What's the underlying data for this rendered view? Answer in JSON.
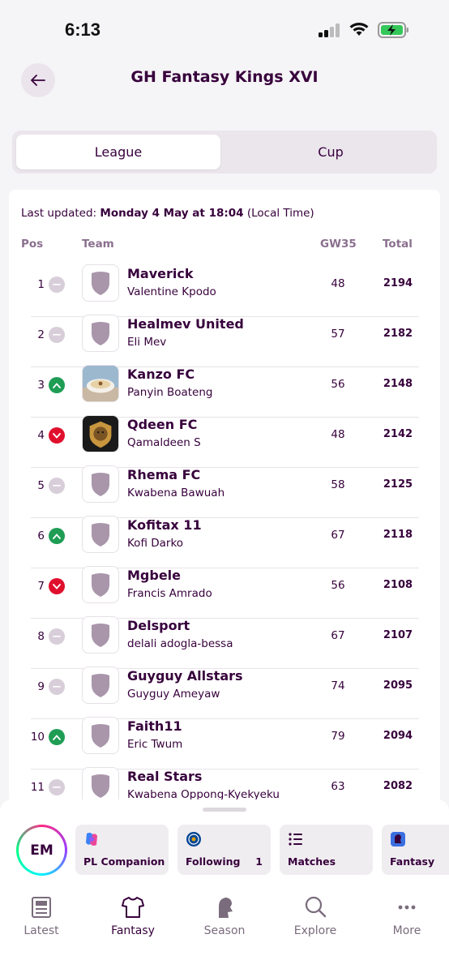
{
  "status": {
    "time": "6:13"
  },
  "header": {
    "title": "GH Fantasy Kings XVI"
  },
  "tabs": [
    {
      "label": "League",
      "active": true
    },
    {
      "label": "Cup",
      "active": false
    }
  ],
  "updated": {
    "prefix": "Last updated:",
    "value": "Monday 4 May at 18:04",
    "suffix": "(Local Time)"
  },
  "columns": {
    "pos": "Pos",
    "team": "Team",
    "gw": "GW35",
    "total": "Total"
  },
  "rows": [
    {
      "pos": "1",
      "move": "same",
      "badge": "shield",
      "team": "Maverick",
      "manager": "Valentine Kpodo",
      "gw": "48",
      "total": "2194"
    },
    {
      "pos": "2",
      "move": "same",
      "badge": "shield",
      "team": "Healmev United",
      "manager": "Eli Mev",
      "gw": "57",
      "total": "2182"
    },
    {
      "pos": "3",
      "move": "up",
      "badge": "photo-bowl",
      "team": "Kanzo FC",
      "manager": "Panyin Boateng",
      "gw": "56",
      "total": "2148"
    },
    {
      "pos": "4",
      "move": "down",
      "badge": "lion",
      "team": "Qdeen FC",
      "manager": "Qamaldeen S",
      "gw": "48",
      "total": "2142"
    },
    {
      "pos": "5",
      "move": "same",
      "badge": "shield",
      "team": "Rhema FC",
      "manager": "Kwabena Bawuah",
      "gw": "58",
      "total": "2125"
    },
    {
      "pos": "6",
      "move": "up",
      "badge": "shield",
      "team": "Kofitax 11",
      "manager": "Kofi Darko",
      "gw": "67",
      "total": "2118"
    },
    {
      "pos": "7",
      "move": "down",
      "badge": "shield",
      "team": "Mgbele",
      "manager": "Francis Amrado",
      "gw": "56",
      "total": "2108"
    },
    {
      "pos": "8",
      "move": "same",
      "badge": "shield",
      "team": "Delsport",
      "manager": "delali adogla-bessa",
      "gw": "67",
      "total": "2107"
    },
    {
      "pos": "9",
      "move": "same",
      "badge": "shield",
      "team": "Guyguy Allstars",
      "manager": "Guyguy Ameyaw",
      "gw": "74",
      "total": "2095"
    },
    {
      "pos": "10",
      "move": "up",
      "badge": "shield",
      "team": "Faith11",
      "manager": "Eric Twum",
      "gw": "79",
      "total": "2094"
    },
    {
      "pos": "11",
      "move": "same",
      "badge": "shield",
      "team": "Real Stars",
      "manager": "Kwabena Oppong-Kyekyeku",
      "gw": "63",
      "total": "2082"
    }
  ],
  "user": {
    "initials": "EM"
  },
  "chips": [
    {
      "label": "PL Companion",
      "icon": "copilot-icon"
    },
    {
      "label": "Following",
      "icon": "chelsea-crest-icon",
      "count": "1"
    },
    {
      "label": "Matches",
      "icon": "list-icon"
    },
    {
      "label": "Fantasy",
      "icon": "pl-lion-icon"
    }
  ],
  "nav": [
    {
      "label": "Latest",
      "icon": "news-icon"
    },
    {
      "label": "Fantasy",
      "icon": "shirt-icon",
      "active": true
    },
    {
      "label": "Season",
      "icon": "pl-lion-icon"
    },
    {
      "label": "Explore",
      "icon": "search-icon"
    },
    {
      "label": "More",
      "icon": "more-icon"
    }
  ],
  "colors": {
    "primary": "#37003c",
    "up": "#1f9d55",
    "down": "#e0102d",
    "same": "#d8ced9",
    "badge": "#a996ab"
  }
}
